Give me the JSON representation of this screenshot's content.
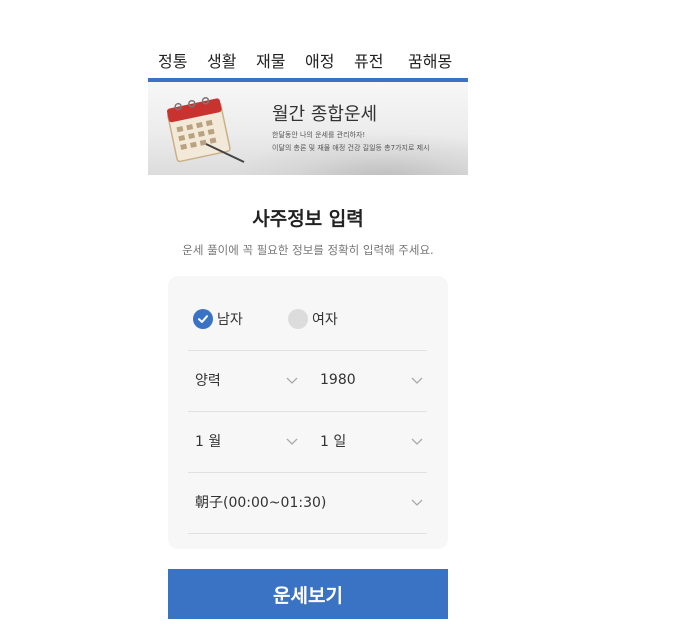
{
  "tabs": [
    "정통",
    "생활",
    "재물",
    "애정",
    "퓨전",
    "꿈해몽"
  ],
  "banner": {
    "title": "월간 종합운세",
    "desc1": "한달동안 나의 운세를 관리하자!",
    "desc2": "이달의 총론 및 재물 애정 건강 길일등 총7가지로 제시"
  },
  "form": {
    "title": "사주정보 입력",
    "subtitle": "운세 풀이에 꼭 필요한 정보를 정확히 입력해 주세요.",
    "gender": {
      "male": "남자",
      "female": "여자",
      "selected": "male"
    },
    "calendar_type": "양력",
    "year": "1980",
    "month": "1 월",
    "day": "1 일",
    "hour": "朝子(00:00~01:30)"
  },
  "submit_label": "운세보기",
  "colors": {
    "accent": "#3a73c4",
    "card": "#f7f7f7"
  },
  "icons": {
    "check": "check-icon",
    "chevron": "chevron-down-icon",
    "calendar": "calendar-illustration"
  }
}
